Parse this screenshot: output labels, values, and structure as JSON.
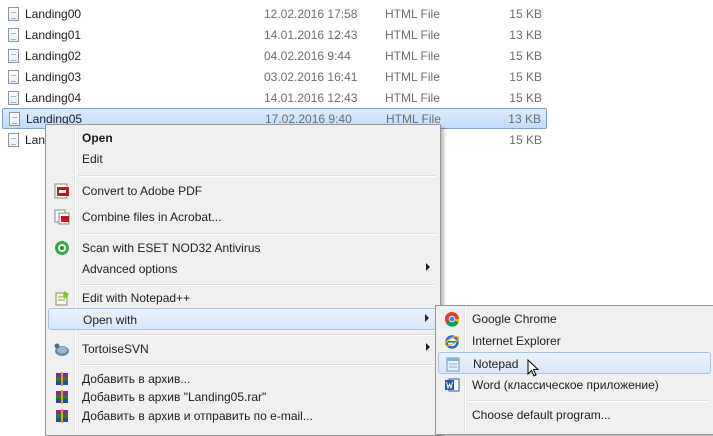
{
  "files": [
    {
      "name": "Landing00",
      "date": "12.02.2016 17:58",
      "type": "HTML File",
      "size": "15 KB"
    },
    {
      "name": "Landing01",
      "date": "14.01.2016 12:43",
      "type": "HTML File",
      "size": "13 KB"
    },
    {
      "name": "Landing02",
      "date": "04.02.2016 9:44",
      "type": "HTML File",
      "size": "15 KB"
    },
    {
      "name": "Landing03",
      "date": "03.02.2016 16:41",
      "type": "HTML File",
      "size": "15 KB"
    },
    {
      "name": "Landing04",
      "date": "14.01.2016 12:43",
      "type": "HTML File",
      "size": "15 KB"
    },
    {
      "name": "Landing05",
      "date": "17.02.2016 9:40",
      "type": "HTML File",
      "size": "13 KB"
    },
    {
      "name": "Lan",
      "date": "",
      "type": "",
      "size": "15 KB"
    }
  ],
  "context_menu": {
    "open": "Open",
    "edit": "Edit",
    "convert_pdf": "Convert to Adobe PDF",
    "combine_acrobat": "Combine files in Acrobat...",
    "scan_eset": "Scan with ESET NOD32 Antivirus",
    "advanced_options": "Advanced options",
    "edit_notepadpp": "Edit with Notepad++",
    "open_with": "Open with",
    "tortoisesvn": "TortoiseSVN",
    "add_archive": "Добавить в архив...",
    "add_archive_rar": "Добавить в архив \"Landing05.rar\"",
    "add_archive_email": "Добавить в архив и отправить по e-mail..."
  },
  "open_with_menu": {
    "chrome": "Google Chrome",
    "ie": "Internet Explorer",
    "notepad": "Notepad",
    "word": "Word (классическое приложение)",
    "choose_default": "Choose default program..."
  }
}
